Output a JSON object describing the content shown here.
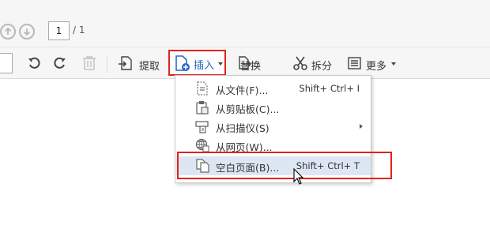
{
  "page_nav": {
    "current_page": "1",
    "total": "/ 1",
    "prev_icon": "arrow-up-circle-icon",
    "next_icon": "arrow-down-circle-icon"
  },
  "toolbar": {
    "undo_icon": "undo-icon",
    "redo_icon": "redo-icon",
    "delete_icon": "trash-icon",
    "extract_label": "提取",
    "insert_label": "插入",
    "replace_label": "替换",
    "split_label": "拆分",
    "more_label": "更多"
  },
  "insert_menu": {
    "items": [
      {
        "label": "从文件(F)...",
        "shortcut": "Shift+ Ctrl+ I",
        "icon": "file-icon"
      },
      {
        "label": "从剪贴板(C)...",
        "shortcut": "",
        "icon": "clipboard-icon"
      },
      {
        "label": "从扫描仪(S)",
        "shortcut": "",
        "icon": "scanner-icon",
        "has_submenu": true
      },
      {
        "label": "从网页(W)...",
        "shortcut": "",
        "icon": "globe-icon"
      },
      {
        "label": "空白页面(B)...",
        "shortcut": "Shift+ Ctrl+ T",
        "icon": "blank-page-icon",
        "active": true
      }
    ]
  },
  "colors": {
    "highlight_border": "#e1231b",
    "active_item_bg": "#dde6f3",
    "accent_blue": "#2b6cc4"
  }
}
